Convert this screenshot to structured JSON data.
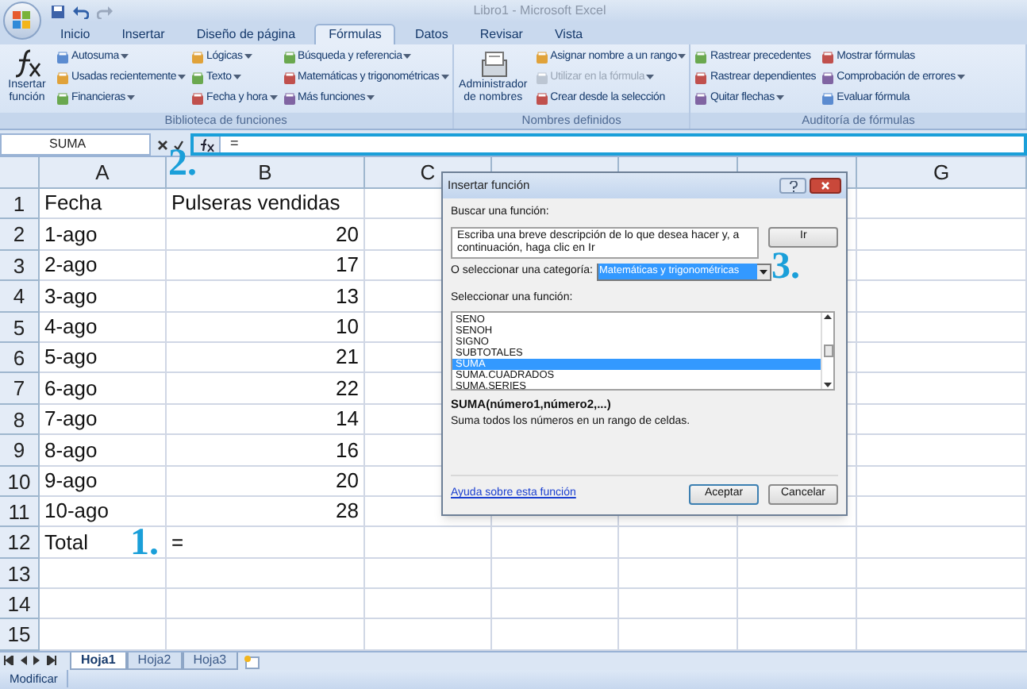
{
  "title_bar": {
    "title": "Libro1 - Microsoft Excel"
  },
  "tabs": [
    {
      "label": "Inicio",
      "selected": false
    },
    {
      "label": "Insertar",
      "selected": false
    },
    {
      "label": "Diseño de página",
      "selected": false
    },
    {
      "label": "Fórmulas",
      "selected": true
    },
    {
      "label": "Datos",
      "selected": false
    },
    {
      "label": "Revisar",
      "selected": false
    },
    {
      "label": "Vista",
      "selected": false
    }
  ],
  "ribbon_groups": [
    {
      "title": "Biblioteca de funciones",
      "big_button": "Insertar función",
      "columns": [
        [
          {
            "label": "Autosuma",
            "dropdown": true,
            "disabled": false
          },
          {
            "label": "Usadas recientemente",
            "dropdown": true,
            "disabled": false
          },
          {
            "label": "Financieras",
            "dropdown": true,
            "disabled": false
          }
        ],
        [
          {
            "label": "Lógicas",
            "dropdown": true,
            "disabled": false
          },
          {
            "label": "Texto",
            "dropdown": true,
            "disabled": false
          },
          {
            "label": "Fecha y hora",
            "dropdown": true,
            "disabled": false
          }
        ],
        [
          {
            "label": "Búsqueda y referencia",
            "dropdown": true,
            "disabled": false
          },
          {
            "label": "Matemáticas y trigonométricas",
            "dropdown": true,
            "disabled": false
          },
          {
            "label": "Más funciones",
            "dropdown": true,
            "disabled": false
          }
        ]
      ]
    },
    {
      "title": "Nombres definidos",
      "big_button": "Administrador de nombres",
      "columns": [
        [
          {
            "label": "Asignar nombre a un rango",
            "dropdown": true,
            "disabled": false
          },
          {
            "label": "Utilizar en la fórmula",
            "dropdown": true,
            "disabled": true
          },
          {
            "label": "Crear desde la selección",
            "dropdown": false,
            "disabled": false
          }
        ]
      ]
    },
    {
      "title": "Auditoría de fórmulas",
      "columns": [
        [
          {
            "label": "Rastrear precedentes",
            "dropdown": false,
            "disabled": false
          },
          {
            "label": "Rastrear dependientes",
            "dropdown": false,
            "disabled": false
          },
          {
            "label": "Quitar flechas",
            "dropdown": true,
            "disabled": false
          }
        ],
        [
          {
            "label": "Mostrar fórmulas",
            "dropdown": false,
            "disabled": false
          },
          {
            "label": "Comprobación de errores",
            "dropdown": true,
            "disabled": false
          },
          {
            "label": "Evaluar fórmula",
            "dropdown": false,
            "disabled": false
          }
        ]
      ]
    }
  ],
  "formula_bar": {
    "name_box": "SUMA",
    "formula": "="
  },
  "sheet": {
    "columns": [
      "A",
      "B",
      "C",
      "",
      "",
      "",
      "G"
    ],
    "rows": [
      {
        "number": "1",
        "cells": [
          {
            "text": "Fecha",
            "kind": "text"
          },
          {
            "text": "Pulseras vendidas",
            "kind": "text"
          }
        ]
      },
      {
        "number": "2",
        "cells": [
          {
            "text": "1-ago",
            "kind": "text"
          },
          {
            "text": "20",
            "kind": "number"
          }
        ]
      },
      {
        "number": "3",
        "cells": [
          {
            "text": "2-ago",
            "kind": "text"
          },
          {
            "text": "17",
            "kind": "number"
          }
        ]
      },
      {
        "number": "4",
        "cells": [
          {
            "text": "3-ago",
            "kind": "text"
          },
          {
            "text": "13",
            "kind": "number"
          }
        ]
      },
      {
        "number": "5",
        "cells": [
          {
            "text": "4-ago",
            "kind": "text"
          },
          {
            "text": "10",
            "kind": "number"
          }
        ]
      },
      {
        "number": "6",
        "cells": [
          {
            "text": "5-ago",
            "kind": "text"
          },
          {
            "text": "21",
            "kind": "number"
          }
        ]
      },
      {
        "number": "7",
        "cells": [
          {
            "text": "6-ago",
            "kind": "text"
          },
          {
            "text": "22",
            "kind": "number"
          }
        ]
      },
      {
        "number": "8",
        "cells": [
          {
            "text": "7-ago",
            "kind": "text"
          },
          {
            "text": "14",
            "kind": "number"
          }
        ]
      },
      {
        "number": "9",
        "cells": [
          {
            "text": "8-ago",
            "kind": "text"
          },
          {
            "text": "16",
            "kind": "number"
          }
        ]
      },
      {
        "number": "10",
        "cells": [
          {
            "text": "9-ago",
            "kind": "text"
          },
          {
            "text": "20",
            "kind": "number"
          }
        ]
      },
      {
        "number": "11",
        "cells": [
          {
            "text": "10-ago",
            "kind": "text"
          },
          {
            "text": "28",
            "kind": "number"
          }
        ]
      },
      {
        "number": "12",
        "cells": [
          {
            "text": "Total",
            "kind": "text"
          },
          {
            "text": "=",
            "kind": "text"
          }
        ]
      },
      {
        "number": "13",
        "cells": []
      },
      {
        "number": "14",
        "cells": []
      },
      {
        "number": "15",
        "cells": []
      }
    ]
  },
  "sheet_tabs": [
    {
      "label": "Hoja1",
      "selected": true
    },
    {
      "label": "Hoja2",
      "selected": false
    },
    {
      "label": "Hoja3",
      "selected": false
    }
  ],
  "status_bar": {
    "mode": "Modificar"
  },
  "annotations": [
    "1.",
    "2.",
    "3."
  ],
  "dialog": {
    "title": "Insertar función",
    "search_label": "Buscar una función:",
    "search_value": "Escriba una breve descripción de lo que desea hacer y, a continuación, haga clic en Ir",
    "go_button": "Ir",
    "category_label": "O seleccionar una categoría:",
    "category_value": "Matemáticas y trigonométricas",
    "list_label": "Seleccionar una función:",
    "functions": [
      {
        "label": "SENO",
        "selected": false
      },
      {
        "label": "SENOH",
        "selected": false
      },
      {
        "label": "SIGNO",
        "selected": false
      },
      {
        "label": "SUBTOTALES",
        "selected": false
      },
      {
        "label": "SUMA",
        "selected": true
      },
      {
        "label": "SUMA.CUADRADOS",
        "selected": false
      },
      {
        "label": "SUMA.SERIES",
        "selected": false
      }
    ],
    "signature": "SUMA(número1,número2,...)",
    "description": "Suma todos los números en un rango de celdas.",
    "help_link": "Ayuda sobre esta función",
    "buttons": [
      "Aceptar",
      "Cancelar"
    ]
  }
}
